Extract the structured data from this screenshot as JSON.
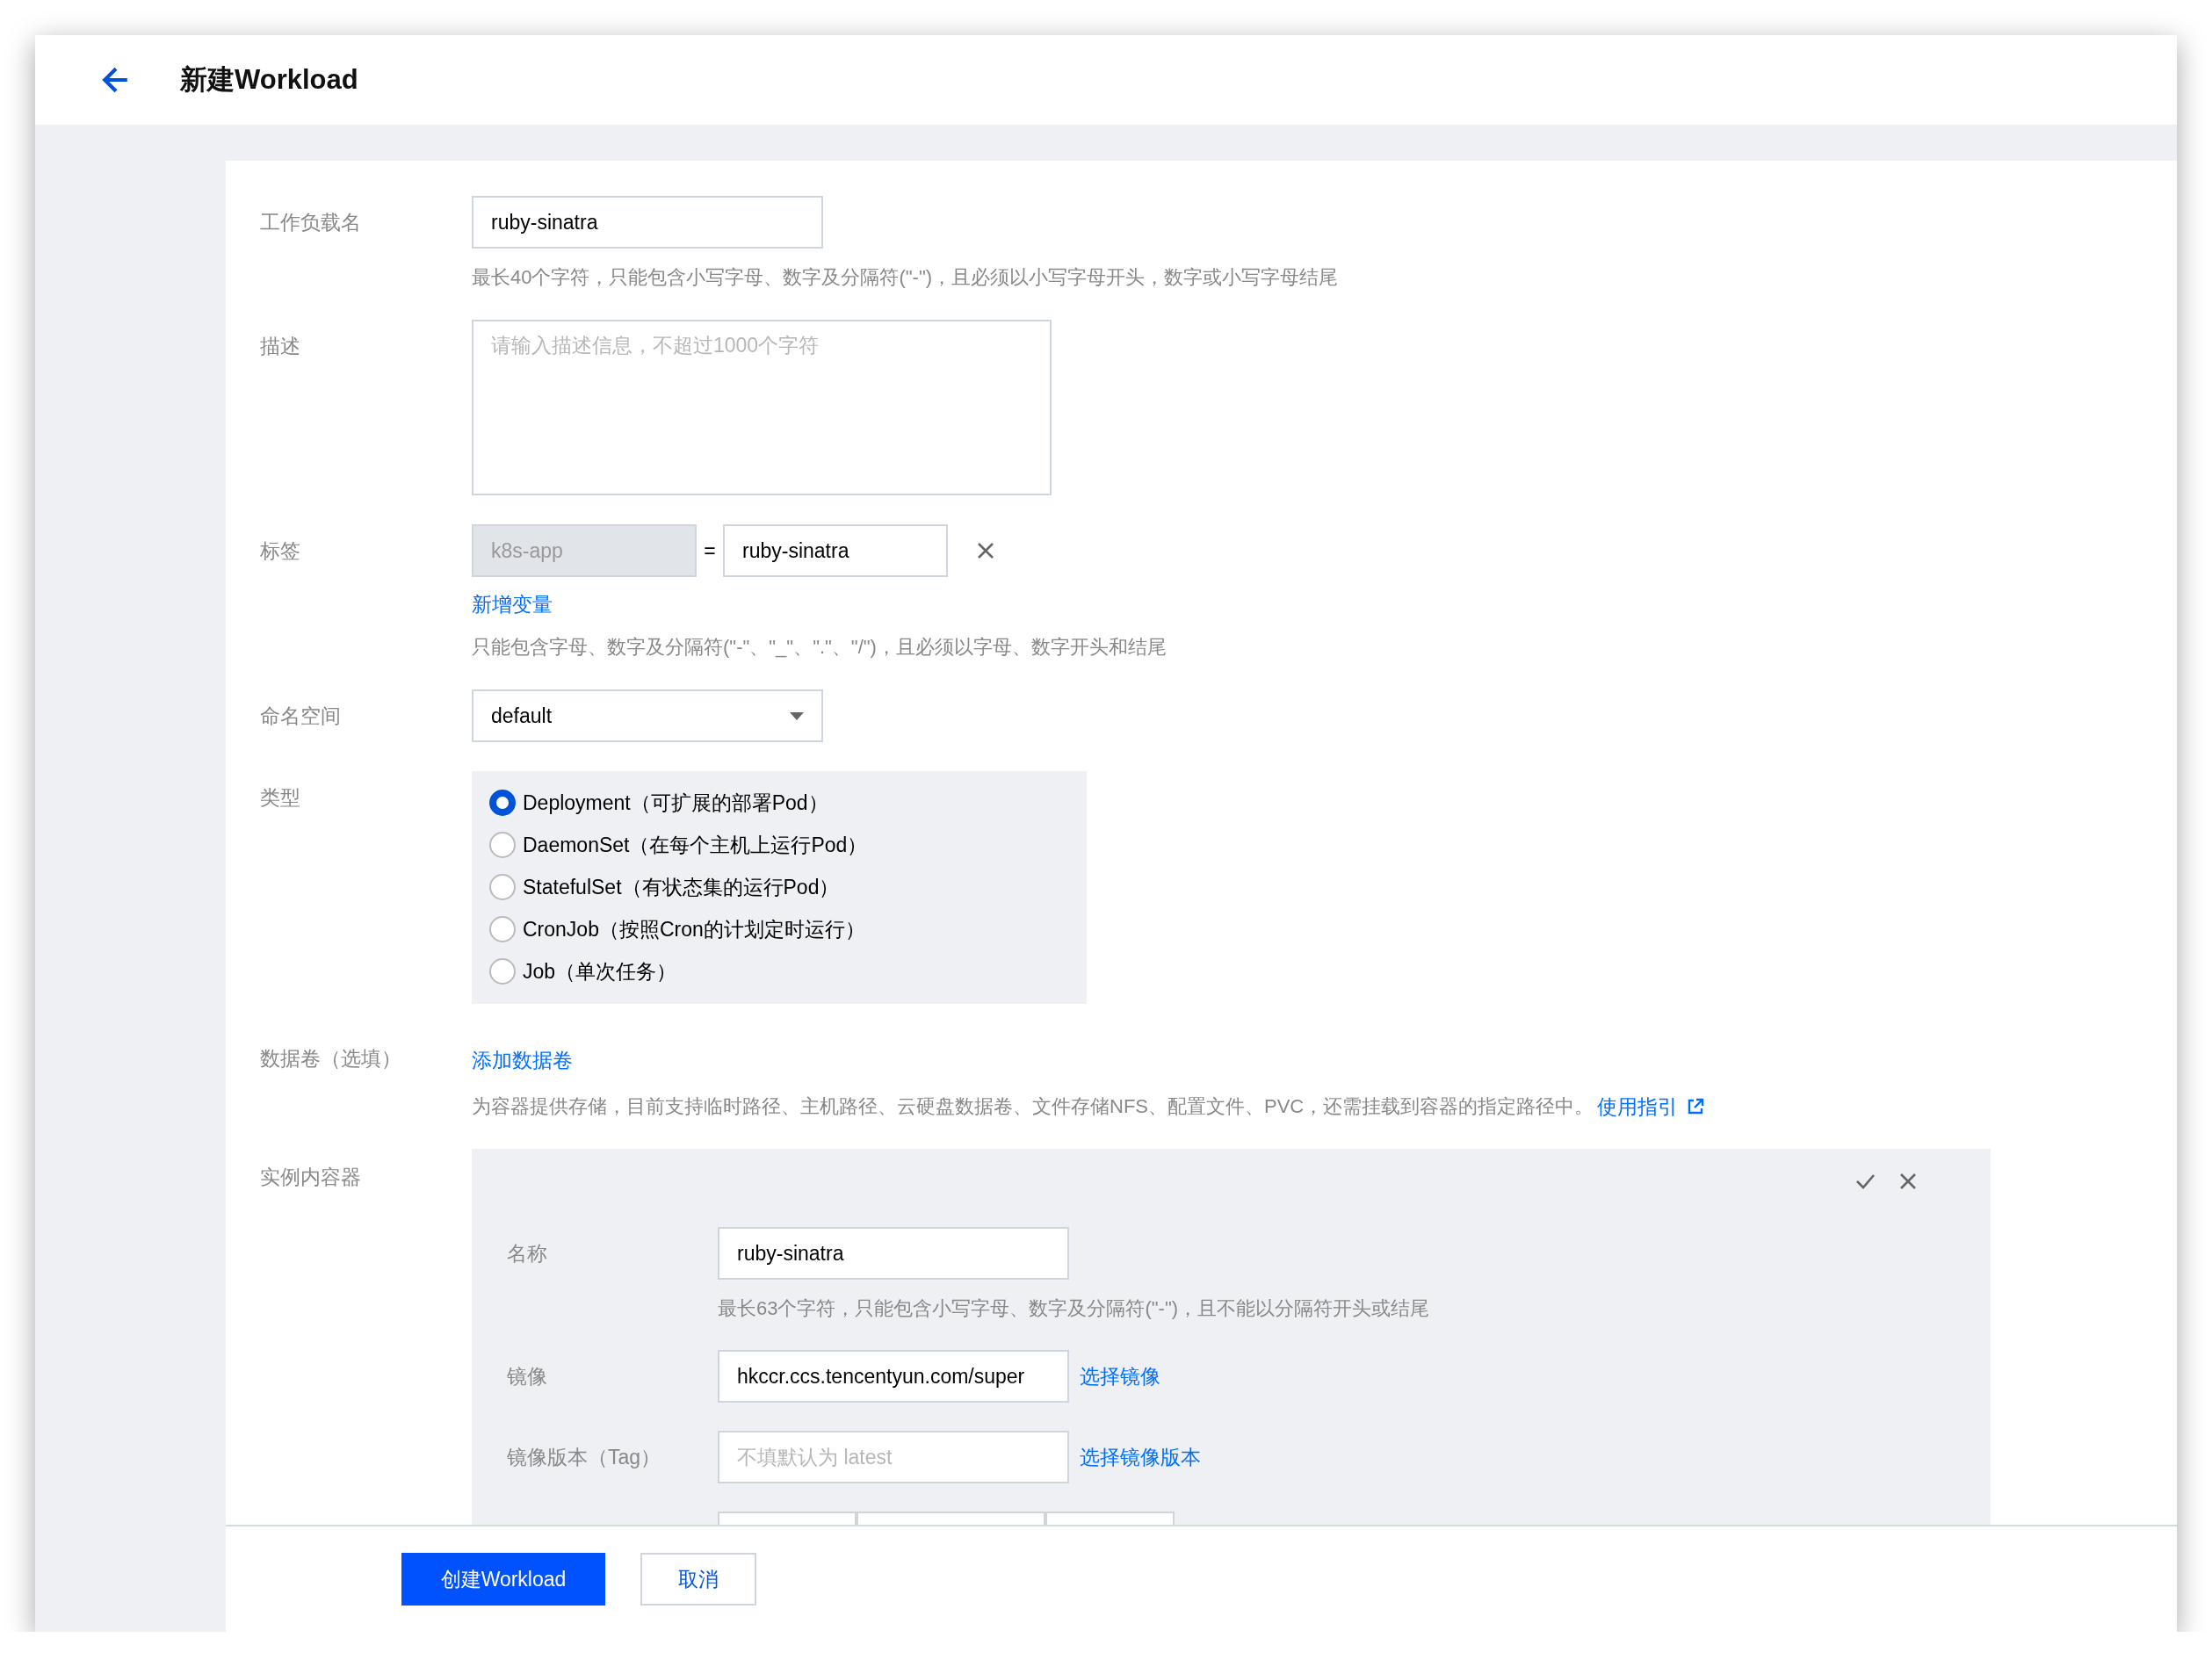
{
  "header": {
    "title": "新建Workload"
  },
  "form": {
    "workload_name": {
      "label": "工作负载名",
      "value": "ruby-sinatra",
      "hint": "最长40个字符，只能包含小写字母、数字及分隔符(\"-\")，且必须以小写字母开头，数字或小写字母结尾"
    },
    "description": {
      "label": "描述",
      "placeholder": "请输入描述信息，不超过1000个字符"
    },
    "labels": {
      "label": "标签",
      "key": {
        "value": "k8s-app",
        "disabled": true
      },
      "separator": "=",
      "value": "ruby-sinatra",
      "add_link": "新增变量",
      "hint": "只能包含字母、数字及分隔符(\"-\"、\"_\"、\".\"、\"/\")，且必须以字母、数字开头和结尾"
    },
    "namespace": {
      "label": "命名空间",
      "value": "default"
    },
    "type": {
      "label": "类型",
      "options": [
        {
          "text": "Deployment（可扩展的部署Pod）",
          "selected": true
        },
        {
          "text": "DaemonSet（在每个主机上运行Pod）",
          "selected": false
        },
        {
          "text": "StatefulSet（有状态集的运行Pod）",
          "selected": false
        },
        {
          "text": "CronJob（按照Cron的计划定时运行）",
          "selected": false
        },
        {
          "text": "Job（单次任务）",
          "selected": false
        }
      ]
    },
    "volumes": {
      "label": "数据卷（选填）",
      "add_link": "添加数据卷",
      "hint": "为容器提供存储，目前支持临时路径、主机路径、云硬盘数据卷、文件存储NFS、配置文件、PVC，还需挂载到容器的指定路径中。",
      "guide_link": "使用指引"
    },
    "container": {
      "label": "实例内容器",
      "name": {
        "label": "名称",
        "value": "ruby-sinatra",
        "hint": "最长63个字符，只能包含小写字母、数字及分隔符(\"-\")，且不能以分隔符开头或结尾"
      },
      "image": {
        "label": "镜像",
        "value": "hkccr.ccs.tencentyun.com/super",
        "link": "选择镜像"
      },
      "image_tag": {
        "label": "镜像版本（Tag）",
        "placeholder": "不填默认为 latest",
        "link": "选择镜像版本"
      }
    }
  },
  "buttons": [
    {
      "label": "创建Workload",
      "kind": "primary"
    },
    {
      "label": "取消",
      "kind": "secondary"
    }
  ]
}
